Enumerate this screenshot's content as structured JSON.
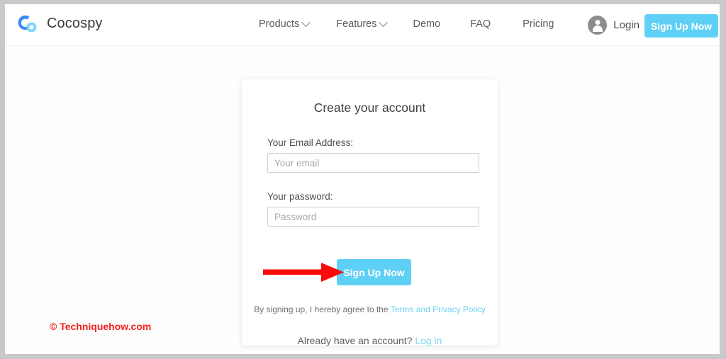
{
  "brand": {
    "name": "Cocospy",
    "logo_icon": "cocospy-logo-icon",
    "logo_color_primary": "#3d8bf5",
    "logo_color_secondary": "#7fd6f8"
  },
  "header": {
    "nav": [
      {
        "label": "Products",
        "has_dropdown": true
      },
      {
        "label": "Features",
        "has_dropdown": true
      },
      {
        "label": "Demo",
        "has_dropdown": false
      },
      {
        "label": "FAQ",
        "has_dropdown": false
      },
      {
        "label": "Pricing",
        "has_dropdown": false
      }
    ],
    "account": {
      "icon": "user-avatar-icon",
      "login_label": "Login"
    },
    "signup_button_label": "Sign Up Now"
  },
  "card": {
    "title": "Create your account",
    "email": {
      "label": "Your Email Address:",
      "value": "",
      "placeholder": "Your email"
    },
    "password": {
      "label": "Your password:",
      "value": "",
      "placeholder": "Password"
    },
    "submit_button_label": "Sign Up Now",
    "terms_text": "By signing up, I hereby agree to the ",
    "terms_link_label": "Terms and Privacy Policy"
  },
  "footer": {
    "login_prompt_text": "Already have an account? ",
    "login_link_label": "Log in"
  },
  "annotation": {
    "arrow_icon": "red-arrow-right-icon",
    "arrow_color": "#fb0a0a",
    "watermark": "© Techniquehow.com",
    "watermark_color": "#f32020"
  },
  "theme": {
    "accent": "#5fd0f5",
    "link": "#6fd2f3",
    "frame": "#c9c9c9"
  }
}
